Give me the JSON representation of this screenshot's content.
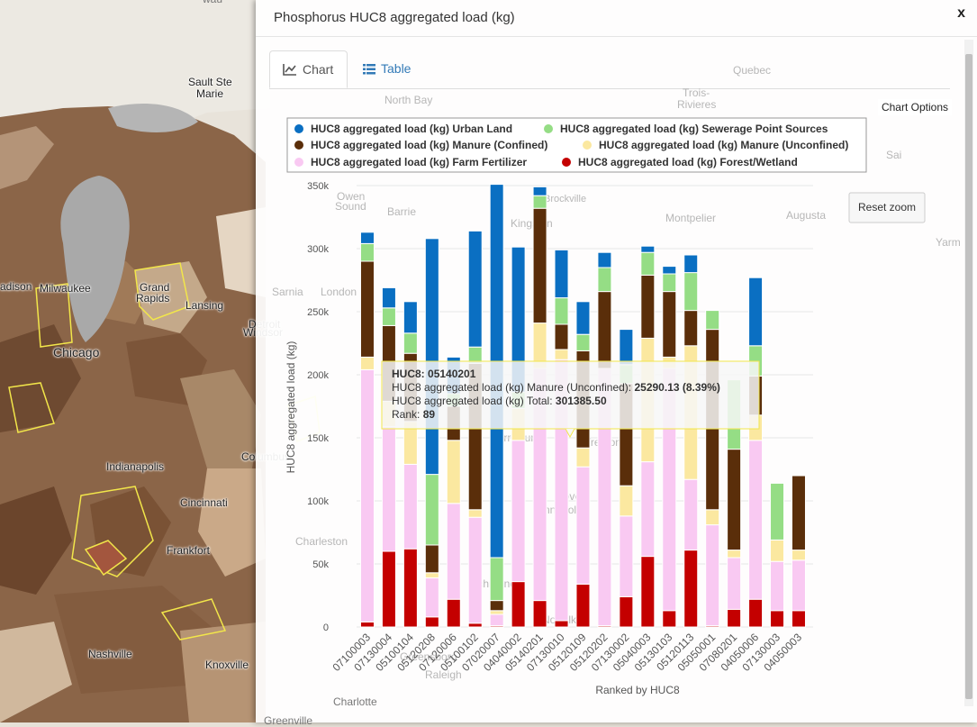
{
  "map": {
    "labels": [
      {
        "text": "Sault Ste",
        "cls": ""
      },
      {
        "text": "Marie",
        "cls": ""
      },
      {
        "text": "Milwaukee",
        "cls": ""
      },
      {
        "text": "Grand",
        "cls": ""
      },
      {
        "text": "Rapids",
        "cls": ""
      },
      {
        "text": "Lansing",
        "cls": ""
      },
      {
        "text": "Chicago",
        "cls": "big"
      },
      {
        "text": "Detroit",
        "cls": ""
      },
      {
        "text": "Windsor",
        "cls": ""
      },
      {
        "text": "Indianapolis",
        "cls": ""
      },
      {
        "text": "Columbus",
        "cls": ""
      },
      {
        "text": "Cincinnati",
        "cls": ""
      },
      {
        "text": "Frankfort",
        "cls": ""
      },
      {
        "text": "Nashville",
        "cls": ""
      },
      {
        "text": "Knoxville",
        "cls": ""
      },
      {
        "text": "adison",
        "cls": ""
      },
      {
        "text": "Charlotte",
        "cls": "faint"
      },
      {
        "text": "Greenville",
        "cls": "faint"
      },
      {
        "text": "wau",
        "cls": "faint"
      }
    ]
  },
  "modal": {
    "title": "Phosphorus HUC8 aggregated load (kg)",
    "close": "x",
    "tabs": {
      "chart": "Chart",
      "table": "Table"
    },
    "chart_options": "Chart Options",
    "reset_zoom": "Reset zoom"
  },
  "colors": {
    "urban": "#0a6fc2",
    "sewerage": "#95dd85",
    "manure_confined": "#5a2e0a",
    "manure_unconfined": "#fbe8a0",
    "farm_fertilizer": "#f9c9f2",
    "forest_wetland": "#c40000"
  },
  "chart_data": {
    "type": "bar",
    "stacked": true,
    "xlabel": "Ranked by HUC8",
    "ylabel": "HUC8 aggregated load (kg)",
    "ylim": [
      0,
      350000
    ],
    "yticks": [
      "0",
      "50k",
      "100k",
      "150k",
      "200k",
      "250k",
      "300k",
      "350k"
    ],
    "categories": [
      "07100003",
      "07130004",
      "05100104",
      "05120208",
      "07120006",
      "05100102",
      "07020007",
      "04040002",
      "05140201",
      "07130010",
      "05120109",
      "05120202",
      "07130002",
      "05040003",
      "05130103",
      "05120113",
      "05050001",
      "07080201",
      "04050006",
      "07130003",
      "04050003"
    ],
    "series": [
      {
        "name": "HUC8 aggregated load (kg) Forest/Wetland",
        "key": "forest_wetland",
        "values": [
          4000,
          60000,
          62000,
          8000,
          22000,
          3000,
          1000,
          36000,
          21000,
          5000,
          34000,
          1000,
          24000,
          56000,
          13000,
          61000,
          1000,
          14000,
          22000,
          13000,
          13000
        ]
      },
      {
        "name": "HUC8 aggregated load (kg) Farm Fertilizer",
        "key": "farm_fertilizer",
        "values": [
          200000,
          99000,
          67000,
          31000,
          76000,
          84000,
          9000,
          112000,
          184000,
          207000,
          93000,
          204000,
          64000,
          75000,
          192000,
          56000,
          80000,
          41000,
          126000,
          39000,
          40000
        ]
      },
      {
        "name": "HUC8 aggregated load (kg) Manure (Unconfined)",
        "key": "manure_unconfined",
        "values": [
          10000,
          20000,
          34000,
          4000,
          50000,
          6000,
          3000,
          25290.13,
          36000,
          8000,
          15000,
          0,
          24000,
          98000,
          9000,
          106000,
          12000,
          6000,
          20000,
          17000,
          8000
        ]
      },
      {
        "name": "HUC8 aggregated load (kg) Manure (Confined)",
        "key": "manure_confined",
        "values": [
          76000,
          60000,
          54000,
          22000,
          27000,
          116000,
          8000,
          0,
          91000,
          20000,
          77000,
          61000,
          81000,
          50000,
          52000,
          28000,
          143000,
          80000,
          31000,
          0,
          59000
        ]
      },
      {
        "name": "HUC8 aggregated load (kg) Sewerage Point Sources",
        "key": "sewerage",
        "values": [
          14000,
          14000,
          16000,
          56000,
          10000,
          13000,
          34000,
          13000,
          10000,
          21000,
          13000,
          19000,
          15000,
          18000,
          14000,
          30000,
          15000,
          55000,
          24000,
          45000,
          0
        ]
      },
      {
        "name": "HUC8 aggregated load (kg) Urban Land",
        "key": "urban",
        "values": [
          9000,
          16000,
          25000,
          187000,
          29000,
          92000,
          296000,
          115000,
          7000,
          38000,
          26000,
          12000,
          28000,
          5000,
          6000,
          14000,
          0,
          0,
          54000,
          0,
          0
        ]
      }
    ],
    "legend_order": [
      "urban",
      "sewerage",
      "manure_confined",
      "manure_unconfined",
      "farm_fertilizer",
      "forest_wetland"
    ],
    "legend_placement": "top",
    "tooltip": {
      "line1_label": "HUC8: ",
      "line1_value": "05140201",
      "line2_label": "HUC8 aggregated load (kg) Manure (Unconfined): ",
      "line2_value": "25290.13 (8.39%)",
      "line3_label": "HUC8 aggregated load (kg) Total: ",
      "line3_value": "301385.50",
      "line4_label": "Rank: ",
      "line4_value": "89",
      "target_index": 7
    }
  }
}
